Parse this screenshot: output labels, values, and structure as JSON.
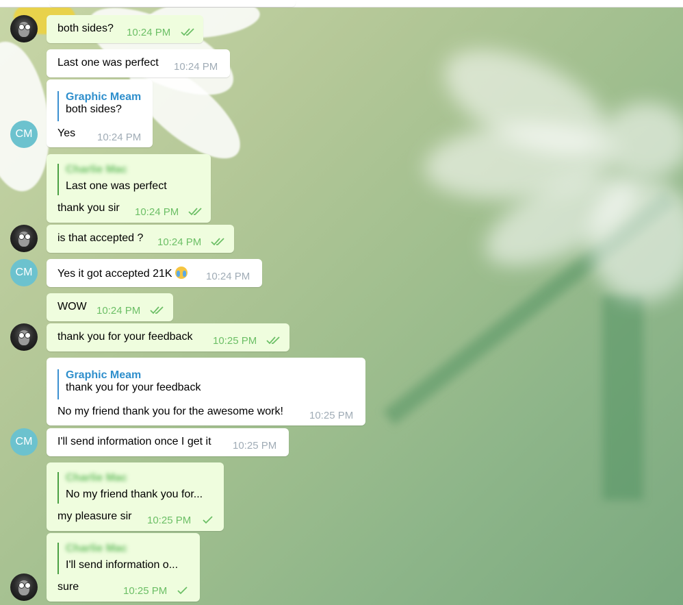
{
  "avatar_initials": "CM",
  "messages": [
    {
      "text": "both sides?",
      "time": "10:24 PM"
    },
    {
      "text": "Last one was perfect",
      "time": "10:24 PM"
    },
    {
      "reply_name": "Graphic Meam",
      "reply_text": "both sides?",
      "text": "Yes",
      "time": "10:24 PM"
    },
    {
      "reply_name": "Charlie Mac",
      "reply_text": "Last one was perfect",
      "text": "thank you sir",
      "time": "10:24 PM"
    },
    {
      "text": "is that accepted ?",
      "time": "10:24 PM"
    },
    {
      "text": "Yes it got accepted 21K",
      "time": "10:24 PM",
      "emoji": "crying-face"
    },
    {
      "text": "WOW",
      "time": "10:24 PM"
    },
    {
      "text": "thank you for your feedback",
      "time": "10:25 PM"
    },
    {
      "reply_name": "Graphic Meam",
      "reply_text": "thank you for your feedback",
      "text": "No my friend thank you for the awesome work!",
      "time": "10:25 PM"
    },
    {
      "text": "I'll send information once I get it",
      "time": "10:25 PM"
    },
    {
      "reply_name": "Charlie Mac",
      "reply_text": "No my friend thank you for...",
      "text": "my pleasure sir",
      "time": "10:25 PM"
    },
    {
      "reply_name": "Charlie Mac",
      "reply_text": "I'll send information o...",
      "text": "sure",
      "time": "10:25 PM"
    }
  ]
}
